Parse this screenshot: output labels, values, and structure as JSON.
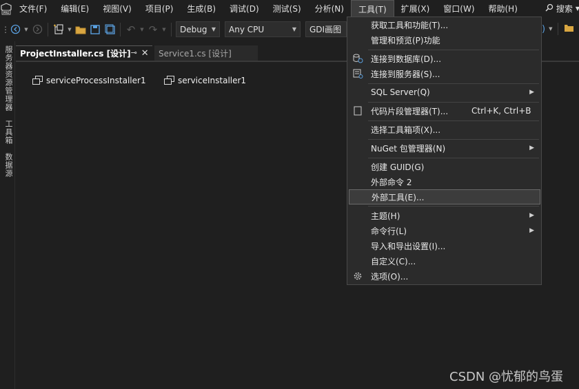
{
  "menubar": {
    "logo_text": "PRE",
    "items": [
      "文件(F)",
      "编辑(E)",
      "视图(V)",
      "项目(P)",
      "生成(B)",
      "调试(D)",
      "测试(S)",
      "分析(N)",
      "工具(T)",
      "扩展(X)",
      "窗口(W)",
      "帮助(H)"
    ],
    "active_item": "工具(T)",
    "search_label": "搜索"
  },
  "toolbar": {
    "configuration": "Debug",
    "platform": "Any CPU",
    "target": "GDI画图"
  },
  "sidebar": {
    "panels": [
      "服务器资源管理器",
      "工具箱",
      "数据源"
    ]
  },
  "tabs": [
    {
      "label": "ProjectInstaller.cs [设计]",
      "active": true
    },
    {
      "label": "Service1.cs [设计]",
      "active": false
    }
  ],
  "designer": {
    "components": [
      "serviceProcessInstaller1",
      "serviceInstaller1"
    ]
  },
  "tools_menu": {
    "items": [
      {
        "label": "获取工具和功能(T)...",
        "icon": "",
        "shortcut": "",
        "submenu": false
      },
      {
        "label": "管理和预览(P)功能",
        "icon": "",
        "shortcut": "",
        "submenu": false
      },
      {
        "label": "连接到数据库(D)...",
        "icon": "database-connect-icon",
        "shortcut": "",
        "submenu": false
      },
      {
        "label": "连接到服务器(S)...",
        "icon": "server-connect-icon",
        "shortcut": "",
        "submenu": false
      },
      {
        "label": "SQL Server(Q)",
        "icon": "",
        "shortcut": "",
        "submenu": true
      },
      {
        "label": "代码片段管理器(T)...",
        "icon": "snippet-icon",
        "shortcut": "Ctrl+K, Ctrl+B",
        "submenu": false
      },
      {
        "label": "选择工具箱项(X)...",
        "icon": "",
        "shortcut": "",
        "submenu": false
      },
      {
        "label": "NuGet 包管理器(N)",
        "icon": "",
        "shortcut": "",
        "submenu": true
      },
      {
        "label": "创建 GUID(G)",
        "icon": "",
        "shortcut": "",
        "submenu": false
      },
      {
        "label": "外部命令 2",
        "icon": "",
        "shortcut": "",
        "submenu": false
      },
      {
        "label": "外部工具(E)...",
        "icon": "",
        "shortcut": "",
        "submenu": false,
        "highlighted": true
      },
      {
        "label": "主题(H)",
        "icon": "",
        "shortcut": "",
        "submenu": true
      },
      {
        "label": "命令行(L)",
        "icon": "",
        "shortcut": "",
        "submenu": true
      },
      {
        "label": "导入和导出设置(I)...",
        "icon": "",
        "shortcut": "",
        "submenu": false
      },
      {
        "label": "自定义(C)...",
        "icon": "",
        "shortcut": "",
        "submenu": false
      },
      {
        "label": "选项(O)...",
        "icon": "gear-icon",
        "shortcut": "",
        "submenu": false
      }
    ]
  },
  "watermark": "CSDN @忧郁的鸟蛋",
  "colors": {
    "background": "#1f1f1f",
    "menu_background": "#2b2b2b",
    "highlight": "#3c3c3c"
  }
}
